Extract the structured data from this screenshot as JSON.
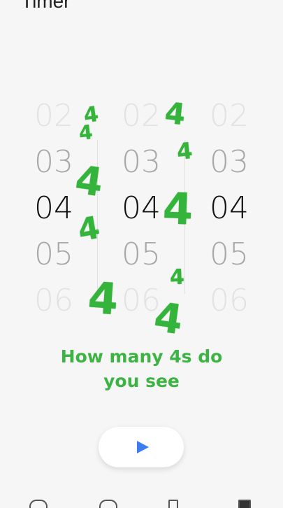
{
  "app": {
    "title": "Timer"
  },
  "picker": {
    "columns": [
      {
        "values": [
          "02",
          "03",
          "04",
          "05",
          "06"
        ],
        "selected": "04"
      },
      {
        "values": [
          "02",
          "03",
          "04",
          "05",
          "06"
        ],
        "selected": "04"
      },
      {
        "values": [
          "02",
          "03",
          "04",
          "05",
          "06"
        ],
        "selected": "04"
      }
    ]
  },
  "overlay": {
    "fours": [
      "4",
      "4",
      "4",
      "4",
      "4",
      "4",
      "4",
      "4",
      "4",
      "4"
    ],
    "caption_line1": "How many 4s do",
    "caption_line2": "you see",
    "color": "#34b43a"
  },
  "controls": {
    "play_icon": "play-icon"
  },
  "nav": {
    "icons": [
      "alarm-icon",
      "clock-icon",
      "stopwatch-icon",
      "timer-icon"
    ]
  }
}
